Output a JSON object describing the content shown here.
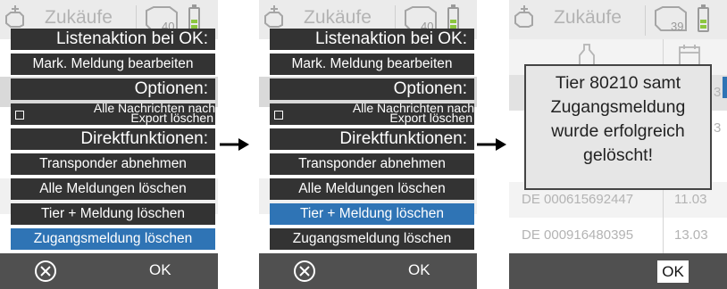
{
  "header": {
    "title": "Zukäufe",
    "count_1": "40",
    "count_2": "40",
    "count_3": "39"
  },
  "menu": {
    "list_header": "Listenaktion bei OK:",
    "edit_item": "Mark. Meldung bearbeiten",
    "options_header": "Optionen:",
    "checkbox_line1": "Alle Nachrichten nach",
    "checkbox_line2": "Export löschen",
    "direct_header": "Direktfunktionen:",
    "item_transponder": "Transponder abnehmen",
    "item_delete_all": "Alle Meldungen löschen",
    "item_animal_report": "Tier + Meldung löschen",
    "item_entry_report": "Zugangsmeldung löschen"
  },
  "selection": {
    "screen1": "Zugangsmeldung löschen",
    "screen2": "Tier + Meldung löschen"
  },
  "footer": {
    "ok_label": "OK"
  },
  "screen3": {
    "dialog_message": "Tier 80210 samt Zugangsmeldung wurde erfolgreich gelöscht!",
    "rows": [
      {
        "id": "DE 000615692447",
        "date": "11.03"
      },
      {
        "id": "DE 000916480395",
        "date": "13.03"
      }
    ],
    "partial_dates": [
      "3",
      "3"
    ]
  },
  "colors": {
    "menu_bg": "#333333",
    "selected_bg": "#2f74b5",
    "footer_bg": "#505050",
    "battery_green": "#8cc63f"
  },
  "icons": [
    "add-cow-icon",
    "cow-count-icon",
    "battery-icon",
    "cancel-circle-icon",
    "arrow-right-icon",
    "calendar-icon",
    "bottle-icon"
  ]
}
